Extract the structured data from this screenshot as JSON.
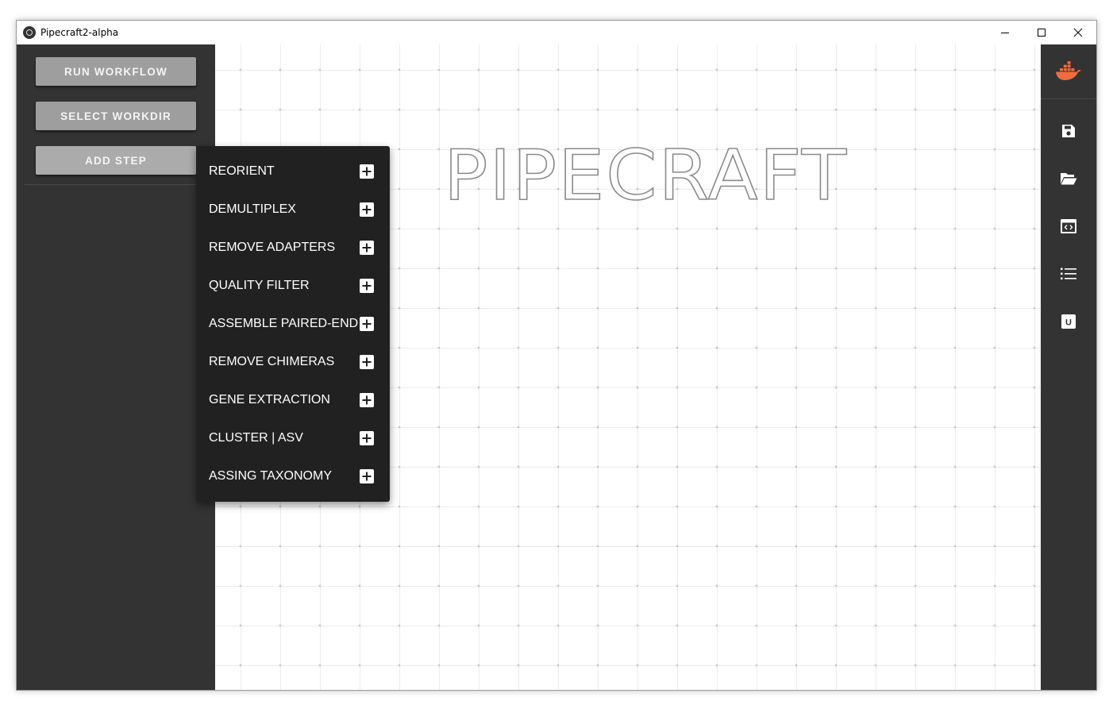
{
  "window": {
    "title": "Pipecraft2-alpha"
  },
  "sidebar": {
    "buttons": [
      {
        "label": "RUN WORKFLOW"
      },
      {
        "label": "SELECT WORKDIR"
      },
      {
        "label": "ADD STEP"
      }
    ]
  },
  "canvas": {
    "logo_text": "PIPECRAFT"
  },
  "add_step_menu": {
    "items": [
      {
        "label": "REORIENT"
      },
      {
        "label": "DEMULTIPLEX"
      },
      {
        "label": "REMOVE ADAPTERS"
      },
      {
        "label": "QUALITY FILTER"
      },
      {
        "label": "ASSEMBLE PAIRED-END"
      },
      {
        "label": "REMOVE CHIMERAS"
      },
      {
        "label": "GENE EXTRACTION"
      },
      {
        "label": "CLUSTER | ASV"
      },
      {
        "label": "ASSING TAXONOMY"
      }
    ]
  },
  "right_toolbar": {
    "icons": [
      "docker-icon",
      "save-icon",
      "folder-open-icon",
      "code-window-icon",
      "list-icon",
      "u-badge-icon"
    ],
    "u_badge_text": "U"
  },
  "colors": {
    "panel_bg": "#333333",
    "button_bg": "#9e9e9e",
    "menu_bg": "#212121",
    "docker_accent": "#f26b3a"
  }
}
